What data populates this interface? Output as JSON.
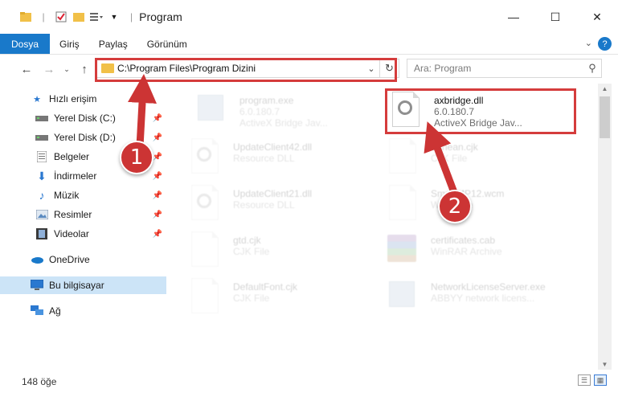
{
  "window": {
    "title": "Program",
    "controls": {
      "minimize": "—",
      "maximize": "☐",
      "close": "✕"
    }
  },
  "ribbon": {
    "tabs": [
      {
        "label": "Dosya",
        "active": true
      },
      {
        "label": "Giriş",
        "active": false
      },
      {
        "label": "Paylaş",
        "active": false
      },
      {
        "label": "Görünüm",
        "active": false
      }
    ],
    "help": "?"
  },
  "navigation": {
    "address": "C:\\Program Files\\Program Dizini",
    "search_placeholder": "Ara: Program"
  },
  "sidebar": {
    "items": [
      {
        "label": "Hızlı erişim",
        "icon": "star-icon"
      },
      {
        "label": "Yerel Disk (C:)",
        "icon": "drive-icon",
        "pinned": true
      },
      {
        "label": "Yerel Disk (D:)",
        "icon": "drive-icon",
        "pinned": true
      },
      {
        "label": "Belgeler",
        "icon": "documents-icon",
        "pinned": true
      },
      {
        "label": "İndirmeler",
        "icon": "download-icon",
        "pinned": true
      },
      {
        "label": "Müzik",
        "icon": "music-icon",
        "pinned": true
      },
      {
        "label": "Resimler",
        "icon": "pictures-icon",
        "pinned": true
      },
      {
        "label": "Videolar",
        "icon": "videos-icon",
        "pinned": true
      },
      {
        "label": "OneDrive",
        "icon": "cloud-icon"
      },
      {
        "label": "Bu bilgisayar",
        "icon": "computer-icon",
        "selected": true
      },
      {
        "label": "Ağ",
        "icon": "network-icon"
      }
    ]
  },
  "files": [
    {
      "name": "program.exe",
      "line2": "6.0.180.7",
      "line3": "ActiveX Bridge Jav...",
      "icon": "exe-icon",
      "faded": true
    },
    {
      "name": "axbridge.dll",
      "line2": "6.0.180.7",
      "line3": "ActiveX Bridge  Jav...",
      "icon": "dll-gear-icon",
      "faded": false
    },
    {
      "name": "UpdateClient42.dll",
      "line2": "Resource DLL",
      "icon": "dll-gear-icon",
      "faded": true
    },
    {
      "name": "Schean.cjk",
      "line2": "CJK File",
      "icon": "file-icon",
      "faded": true
    },
    {
      "name": "UpdateClient21.dll",
      "line2": "Resource DLL",
      "icon": "dll-gear-icon",
      "faded": true
    },
    {
      "name": "SmartMP12.wcm",
      "line2": "WCM File",
      "icon": "file-icon",
      "faded": true
    },
    {
      "name": "gtd.cjk",
      "line2": "CJK File",
      "icon": "file-icon",
      "faded": true
    },
    {
      "name": "certificates.cab",
      "line2": "WinRAR Archive",
      "icon": "winrar-icon",
      "faded": true
    },
    {
      "name": "DefaultFont.cjk",
      "line2": "CJK File",
      "icon": "file-icon",
      "faded": true
    },
    {
      "name": "NetworkLicenseServer.exe",
      "line2": "ABBYY network licens...",
      "icon": "exe-icon",
      "faded": true
    }
  ],
  "status": {
    "count": "148 öğe"
  },
  "annotations": {
    "step1": "1",
    "step2": "2",
    "color": "#cc3434"
  }
}
